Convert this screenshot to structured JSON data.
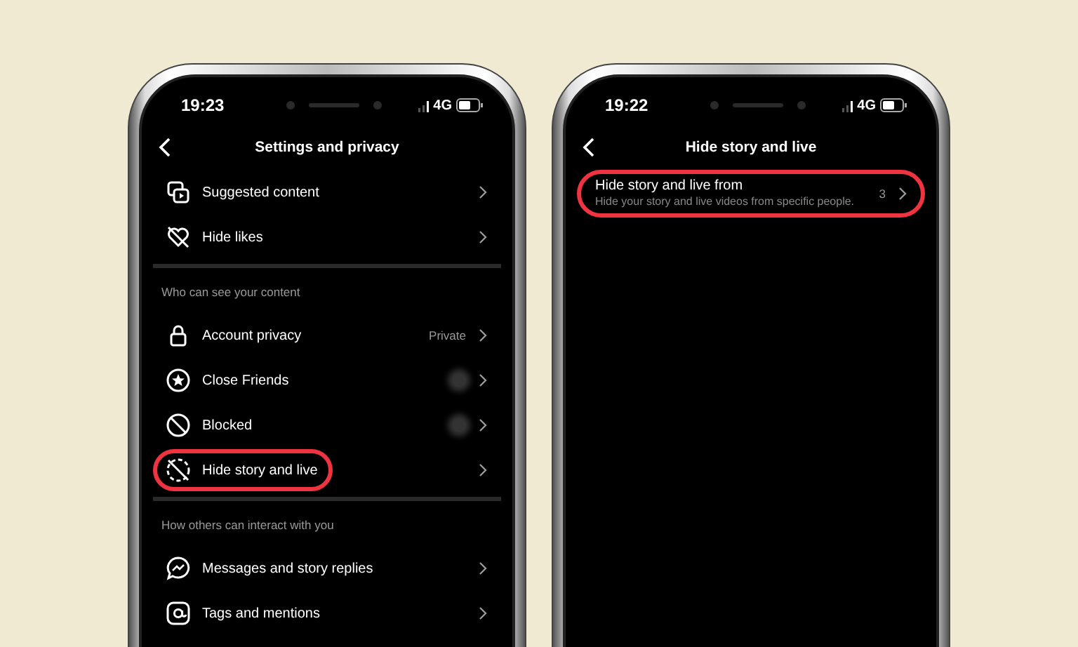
{
  "phones": [
    {
      "time": "19:23",
      "network": "4G",
      "title": "Settings and privacy",
      "sections": [
        {
          "items": [
            {
              "label": "Suggested content",
              "highlighted": false
            },
            {
              "label": "Hide likes",
              "highlighted": false
            }
          ]
        },
        {
          "heading": "Who can see your content",
          "items": [
            {
              "label": "Account privacy",
              "value": "Private",
              "highlighted": false
            },
            {
              "label": "Close Friends",
              "highlighted": false,
              "redacted": true
            },
            {
              "label": "Blocked",
              "highlighted": false,
              "redacted": true
            },
            {
              "label": "Hide story and live",
              "highlighted": true
            }
          ]
        },
        {
          "heading": "How others can interact with you",
          "items": [
            {
              "label": "Messages and story replies",
              "highlighted": false
            },
            {
              "label": "Tags and mentions",
              "highlighted": false
            }
          ]
        }
      ]
    },
    {
      "time": "19:22",
      "network": "4G",
      "title": "Hide story and live",
      "sections": [
        {
          "items": [
            {
              "label": "Hide story and live from",
              "description": "Hide your story and live videos from specific people.",
              "value": "3",
              "highlighted": true
            }
          ]
        }
      ]
    }
  ]
}
